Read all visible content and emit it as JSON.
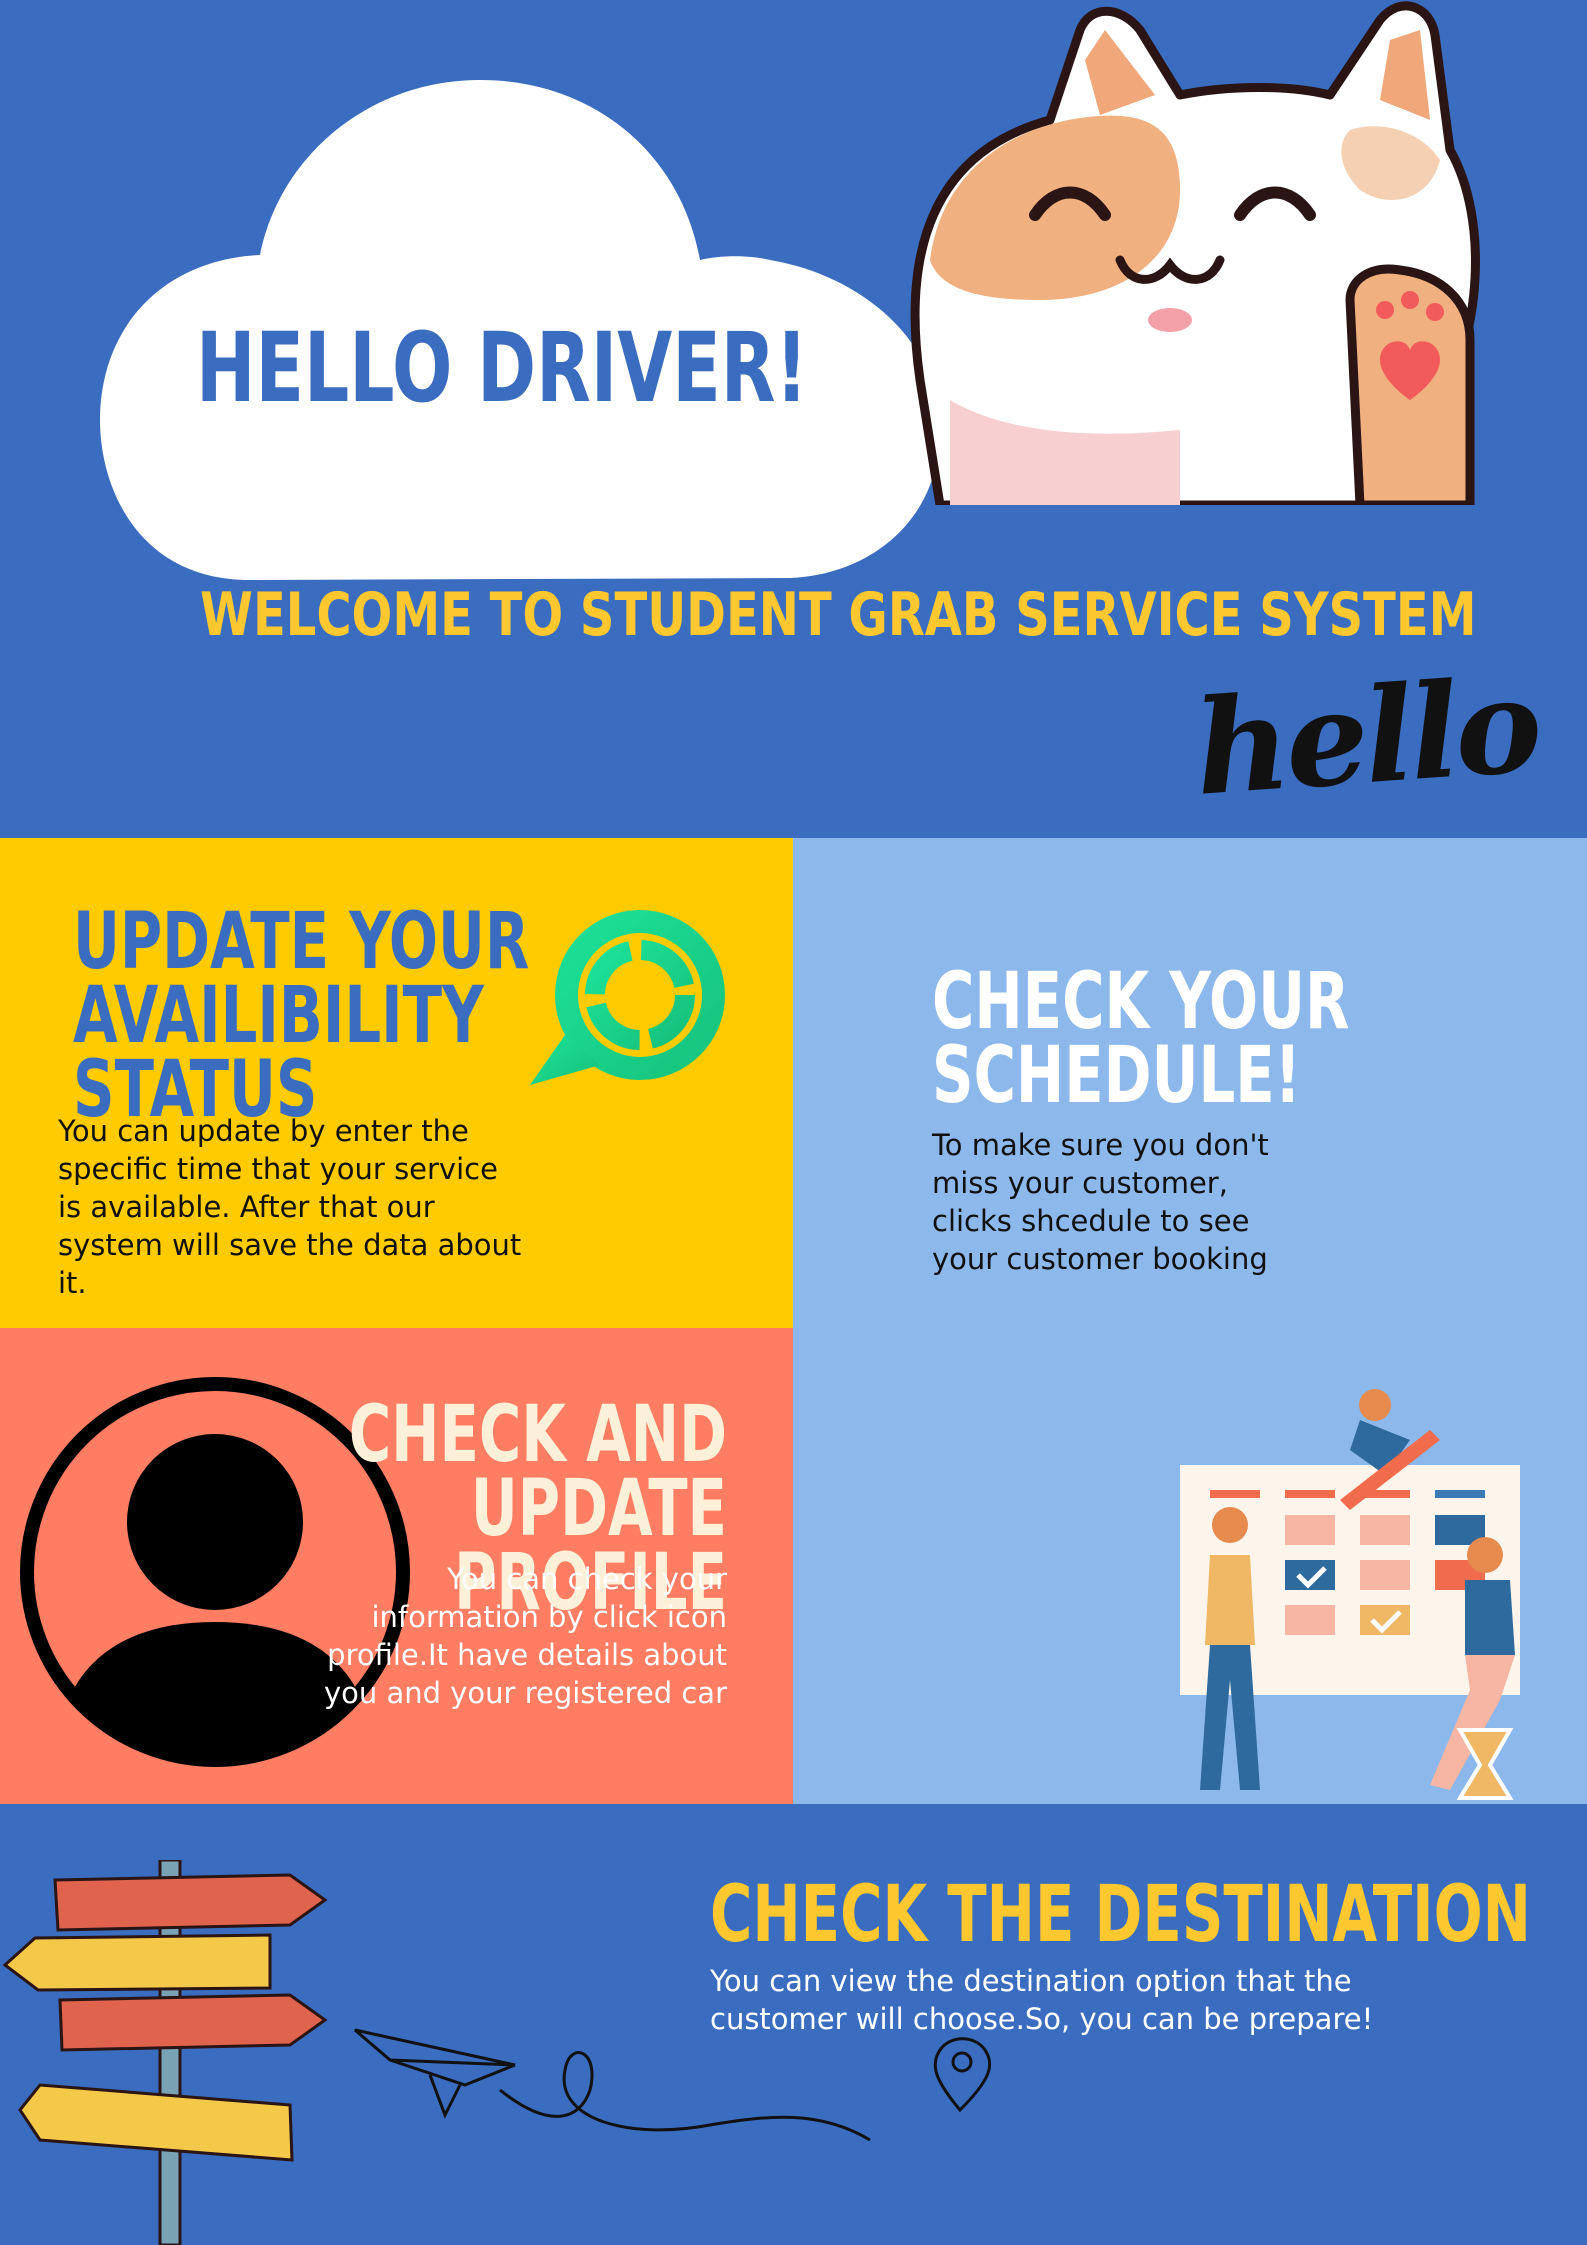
{
  "hero": {
    "title": "HELLO DRIVER!",
    "welcome": "WELCOME TO STUDENT GRAB SERVICE SYSTEM",
    "script_greeting": "hello"
  },
  "availability": {
    "title_line1": "UPDATE YOUR",
    "title_line2": "AVAILIBILITY",
    "title_line3": "STATUS",
    "text": "You can update by enter the specific time that your service is available. After that our system will save the data about it."
  },
  "schedule": {
    "title_line1": "CHECK YOUR",
    "title_line2": "SCHEDULE!",
    "text": "To  make sure you don't miss your customer, clicks shcedule to see your customer booking"
  },
  "profile": {
    "title_line1": "CHECK AND",
    "title_line2": "UPDATE PROFILE",
    "text": "You can check your information by click icon profile.It have details about you and your registered car"
  },
  "destination": {
    "title": "CHECK THE DESTINATION",
    "text": "You can view the destination option that the customer will choose.So, you can be prepare!"
  },
  "colors": {
    "blue": "#3a6cc0",
    "yellow": "#fecb00",
    "light_blue": "#8db8eb",
    "coral": "#ff7d62",
    "gold_text": "#fdc82f"
  },
  "icons": [
    "cloud-icon",
    "cat-illustration",
    "chat-sync-icon",
    "profile-icon",
    "calendar-illustration",
    "signpost-icon",
    "paper-plane-icon",
    "location-pin-icon"
  ]
}
